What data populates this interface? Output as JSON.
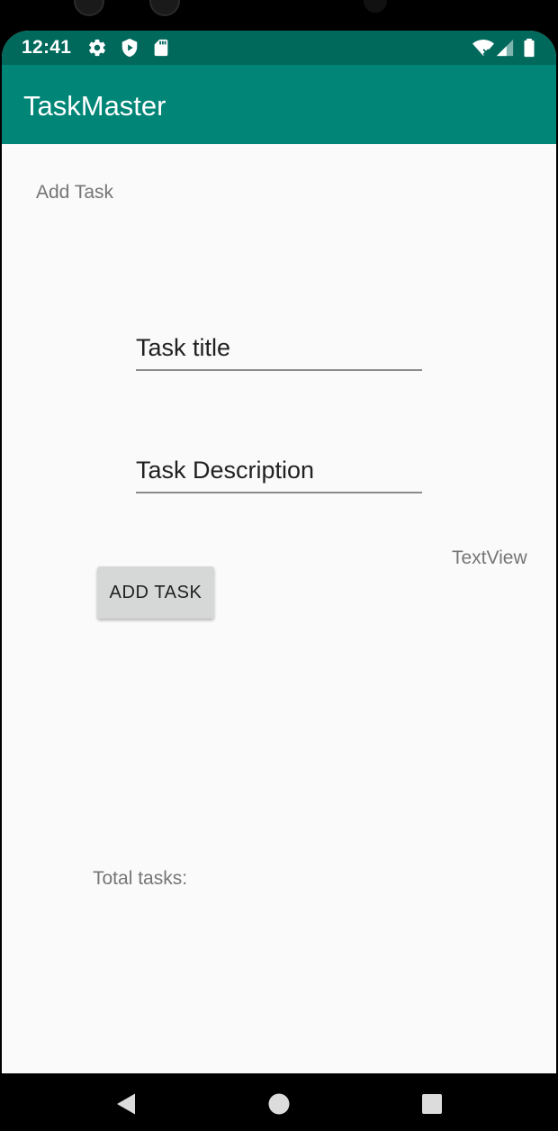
{
  "status_bar": {
    "time": "12:41",
    "left_icons": [
      "gear-icon",
      "shield-icon",
      "sd-card-icon"
    ],
    "right_icons": [
      "wifi-icon",
      "signal-icon",
      "battery-icon"
    ],
    "color": "#00695c"
  },
  "app_bar": {
    "title": "TaskMaster",
    "color": "#008577"
  },
  "form": {
    "heading": "Add Task",
    "title_placeholder": "Task title",
    "description_placeholder": "Task Description",
    "text_view": "TextView",
    "add_button_label": "ADD TASK",
    "total_tasks_label": "Total tasks:"
  },
  "nav_bar": {
    "buttons": [
      "back-icon",
      "home-icon",
      "recents-icon"
    ]
  }
}
